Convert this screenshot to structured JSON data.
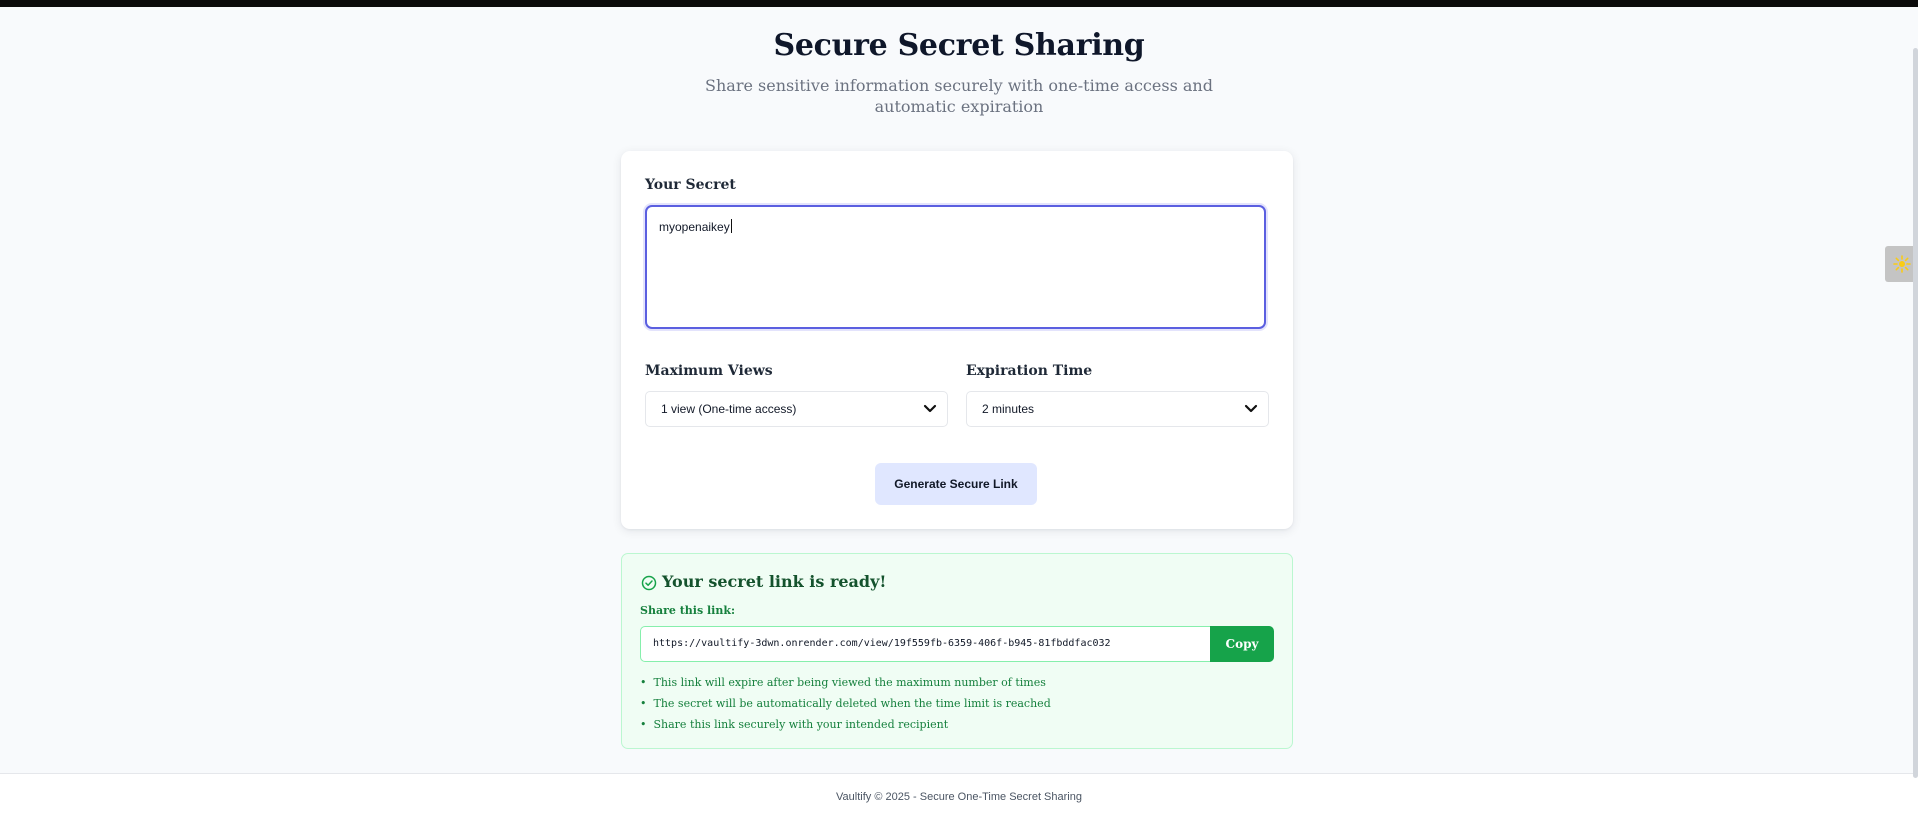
{
  "header": {
    "title": "Secure Secret Sharing",
    "subtitle": "Share sensitive information securely with one-time access and automatic expiration"
  },
  "form": {
    "secret_label": "Your Secret",
    "secret_value": "myopenaikey",
    "max_views_label": "Maximum Views",
    "max_views_selected": "1 view (One-time access)",
    "expiration_label": "Expiration Time",
    "expiration_selected": "2 minutes",
    "generate_button": "Generate Secure Link"
  },
  "result": {
    "title": "Your secret link is ready!",
    "share_label": "Share this link:",
    "link": "https://vaultify-3dwn.onrender.com/view/19f559fb-6359-406f-b945-81fbddfac032",
    "copy_button": "Copy",
    "notes": [
      "This link will expire after being viewed the maximum number of times",
      "The secret will be automatically deleted when the time limit is reached",
      "Share this link securely with your intended recipient"
    ]
  },
  "footer": {
    "text": "Vaultify © 2025 - Secure One-Time Secret Sharing"
  },
  "colors": {
    "accent": "#5b5fe0",
    "success": "#16a34a",
    "button_bg": "#e0e7ff"
  },
  "icons": [
    "check-circle-icon",
    "chevron-down-icon",
    "extension-sun-icon"
  ]
}
